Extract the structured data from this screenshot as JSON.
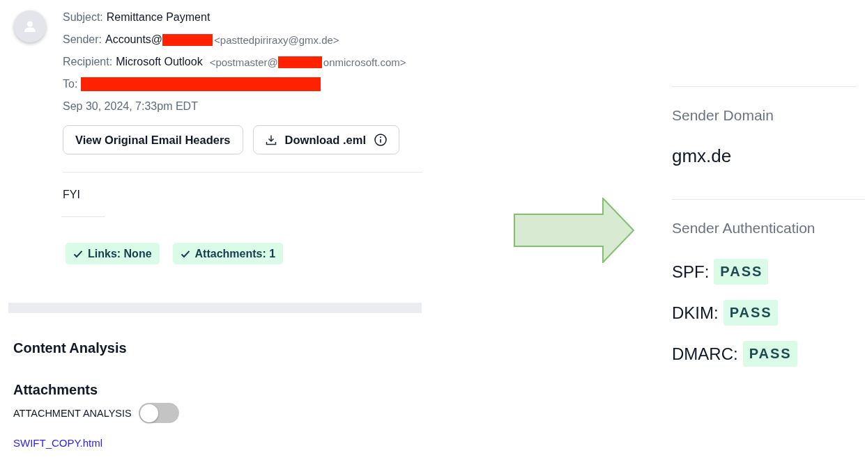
{
  "email": {
    "headers": [
      {
        "label": "Subject:",
        "parts": [
          {
            "kind": "value",
            "text": "Remittance Payment"
          }
        ]
      },
      {
        "label": "Sender:",
        "parts": [
          {
            "kind": "value",
            "text": "Accounts@"
          },
          {
            "kind": "redacted"
          },
          {
            "kind": "address",
            "text": "<pasttedpiriraxy@gmx.de>"
          }
        ]
      },
      {
        "label": "Recipient:",
        "parts": [
          {
            "kind": "value",
            "text": "Microsoft Outlook"
          },
          {
            "kind": "address",
            "text": "<postmaster@"
          },
          {
            "kind": "redacted"
          },
          {
            "kind": "address",
            "text": "onmicrosoft.com>"
          }
        ]
      },
      {
        "label": "To:",
        "parts": [
          {
            "kind": "redacted"
          }
        ]
      }
    ],
    "date": "Sep 30, 2024, 7:33pm EDT",
    "buttons": [
      {
        "label": "View Original Email Headers",
        "kind": "plain"
      },
      {
        "label": "Download .eml",
        "kind": "download"
      }
    ],
    "body": "FYI",
    "badges": [
      {
        "text": "Links: None"
      },
      {
        "text": "Attachments: 1"
      }
    ]
  },
  "content_analysis": {
    "title": "Content Analysis",
    "attachments": {
      "title": "Attachments",
      "toggle": {
        "label": "ATTACHMENT ANALYSIS",
        "on": false
      },
      "files": [
        "SWIFT_COPY.html"
      ]
    }
  },
  "sender_domain": {
    "heading": "Sender Domain",
    "value": "gmx.de"
  },
  "sender_authentication": {
    "heading": "Sender Authentication",
    "checks": [
      {
        "name": "SPF:",
        "result": "PASS"
      },
      {
        "name": "DKIM:",
        "result": "PASS"
      },
      {
        "name": "DMARC:",
        "result": "PASS"
      }
    ]
  }
}
